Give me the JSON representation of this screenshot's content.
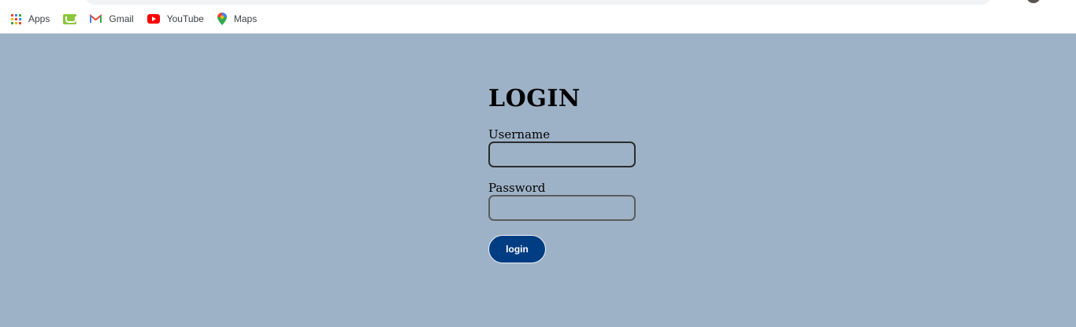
{
  "bookmarks": [
    {
      "icon": "apps-grid-icon",
      "label": "Apps"
    },
    {
      "icon": "green-bookmark-icon",
      "label": ""
    },
    {
      "icon": "gmail-icon",
      "label": "Gmail"
    },
    {
      "icon": "youtube-icon",
      "label": "YouTube"
    },
    {
      "icon": "maps-icon",
      "label": "Maps"
    }
  ],
  "login": {
    "title": "LOGIN",
    "username_label": "Username",
    "username_value": "",
    "password_label": "Password",
    "password_value": "",
    "button_label": "login"
  },
  "colors": {
    "page_background": "#9eb2c7",
    "button_background": "#003d82",
    "button_text": "#ffffff"
  }
}
